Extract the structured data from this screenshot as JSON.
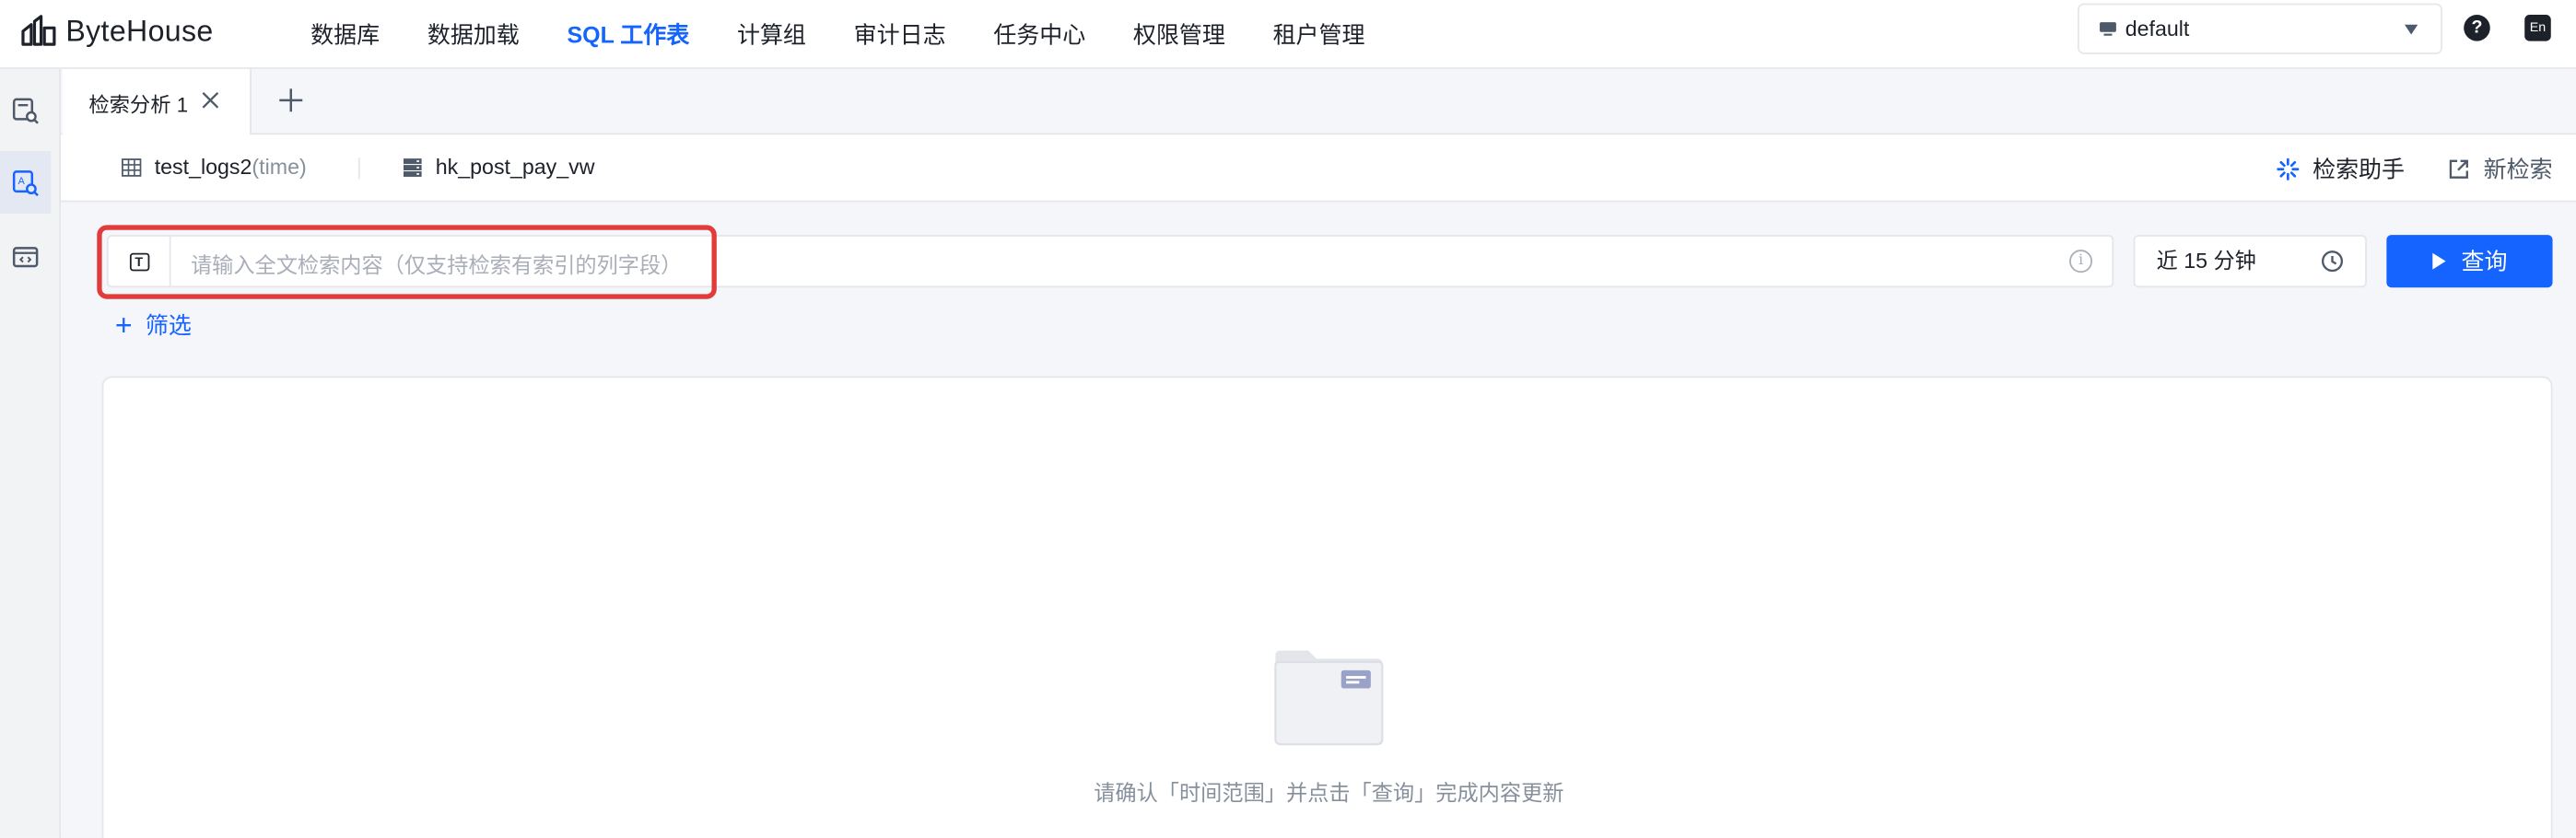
{
  "app": {
    "logo_text": "ByteHouse"
  },
  "nav": {
    "items": [
      "数据库",
      "数据加载",
      "SQL 工作表",
      "计算组",
      "审计日志",
      "任务中心",
      "权限管理",
      "租户管理"
    ],
    "active": "SQL 工作表"
  },
  "header": {
    "database": "default",
    "help": "?",
    "lang": "En"
  },
  "tabs": [
    {
      "label": "检索分析 1"
    }
  ],
  "sources": {
    "table": "test_logs2",
    "table_suffix": "(time)",
    "view": "hk_post_pay_vw"
  },
  "actions": {
    "assistant": "检索助手",
    "new_search": "新检索"
  },
  "search": {
    "placeholder": "请输入全文检索内容（仅支持检索有索引的列字段）",
    "time_range": "近 15 分钟",
    "query_label": "查询",
    "filter_label": "筛选"
  },
  "empty": {
    "message": "请确认「时间范围」并点击「查询」完成内容更新"
  },
  "colors": {
    "accent": "#1664ff",
    "highlight": "#e23b3b"
  }
}
